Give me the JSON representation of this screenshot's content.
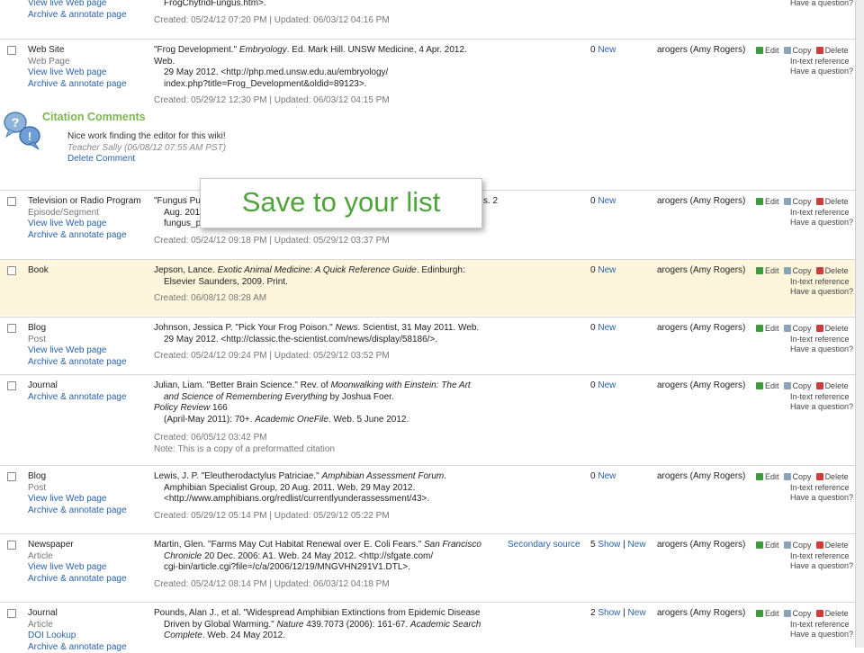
{
  "top_fragment": {
    "type_links": [
      "View live Web page",
      "Archive & annotate page"
    ],
    "cite_tail": "FrogChytridFungus.htm>.",
    "created": "Created: 05/24/12 07:20 PM | Updated: 06/03/12 04:16 PM",
    "question": "Have a question?"
  },
  "actions": {
    "edit": "Edit",
    "copy": "Copy",
    "delete": "Delete",
    "intext": "In-text reference",
    "question": "Have a question?",
    "new": "New",
    "show": "Show",
    "sep": "|"
  },
  "entries": [
    {
      "type": "Web Site",
      "subtype": "Web Page",
      "links": [
        "View live Web page",
        "Archive & annotate page"
      ],
      "cite": [
        "\"Frog Development.\" Embryology. Ed. Mark Hill. UNSW Medicine, 4 Apr. 2012. Web.",
        "29 May 2012. <http://php.med.unsw.edu.au/embryology/",
        "index.php?title=Frog_Development&oldid=89123>."
      ],
      "created": "Created: 05/29/12 12:30 PM | Updated: 06/03/12 04:15 PM",
      "count": "0",
      "owner": "arogers (Amy Rogers)"
    },
    {
      "type": "Television or Radio Program",
      "subtype": "Episode/Segment",
      "links": [
        "View live Web page",
        "Archive & annotate page"
      ],
      "cite": [
        "\"Fungus Pu",
        "Aug. 201",
        "fungus_p"
      ],
      "cite_right": "s. 2",
      "created": "Created: 05/24/12 09:18 PM | Updated: 05/29/12 03:37 PM",
      "count": "0",
      "owner": "arogers (Amy Rogers)"
    },
    {
      "type": "Book",
      "subtype": "",
      "links": [],
      "cite": [
        "Jepson, Lance. Exotic Animal Medicine: A Quick Reference Guide. Edinburgh:",
        "Elsevier Saunders, 2009. Print."
      ],
      "created": "Created: 06/08/12 08:28 AM",
      "count": "0",
      "owner": "arogers (Amy Rogers)"
    },
    {
      "type": "Blog",
      "subtype": "Post",
      "links": [
        "View live Web page",
        "Archive & annotate page"
      ],
      "cite": [
        "Johnson, Jessica P. \"Pick Your Frog Poison.\" News. Scientist, 31 May 2011. Web.",
        "29 May 2012. <http://classic.the-scientist.com/news/display/58186/>."
      ],
      "created": "Created: 05/24/12 09:24 PM | Updated: 05/29/12 03:52 PM",
      "count": "0",
      "owner": "arogers (Amy Rogers)"
    },
    {
      "type": "Journal",
      "subtype": "",
      "links": [
        "Archive & annotate page"
      ],
      "cite": [
        "Julian, Liam. \"Better Brain Science.\" Rev. of Moonwalking with Einstein: The Art",
        "and Science of Remembering Everything by Joshua Foer.",
        "Policy Review 166",
        "(April-May 2011): 70+. Academic OneFile. Web. 5 June 2012."
      ],
      "created": "Created: 06/05/12 03:42 PM",
      "note": "Note: This is a copy of a preformatted citation",
      "count": "0",
      "owner": "arogers (Amy Rogers)"
    },
    {
      "type": "Blog",
      "subtype": "Post",
      "links": [
        "View live Web page",
        "Archive & annotate page"
      ],
      "cite": [
        "Lewis, J. P. \"Eleutherodactylus Patriciae.\" Amphibian Assessment Forum.",
        "Amphibian Specialist Group, 20 Aug. 2011. Web. 29 May 2012.",
        "<http://www.amphibians.org/redlist/currentlyunderassessment/43>."
      ],
      "created": "Created: 05/29/12 05:14 PM | Updated: 05/29/12 05:22 PM",
      "count": "0",
      "owner": "arogers (Amy Rogers)"
    },
    {
      "type": "Newspaper",
      "subtype": "Article",
      "links": [
        "View live Web page",
        "Archive & annotate page"
      ],
      "cite": [
        "Martin, Glen. \"Farms May Cut Habitat Renewal over E. Coli Fears.\" San Francisco",
        "Chronicle 20 Dec. 2006: A1. Web. 24 May 2012. <http://sfgate.com/",
        "cgi-bin/article.cgi?file=/c/a/2006/12/19/MNGVHN291V1.DTL>."
      ],
      "created": "Created: 05/24/12 08:14 PM | Updated: 06/03/12 04:18 PM",
      "source": "Secondary source",
      "count": "5",
      "owner": "arogers (Amy Rogers)"
    },
    {
      "type": "Journal",
      "subtype": "Article",
      "links": [
        "DOI Lookup",
        "Archive & annotate page"
      ],
      "cite": [
        "Pounds, Alan J., et al. \"Widespread Amphibian Extinctions from Epidemic Disease",
        "Driven by Global Warming.\" Nature 439.7073 (2006): 161-67. Academic Search",
        "Complete. Web. 24 May 2012."
      ],
      "created": "",
      "count": "2",
      "owner": "arogers (Amy Rogers)"
    }
  ],
  "comments": {
    "title": "Citation Comments",
    "text": "Nice work finding the editor for this wiki!",
    "signature": "Teacher Sally (06/08/12 07:55 AM PST)",
    "delete_link": "Delete Comment"
  },
  "overlay": {
    "text": "Save to your list"
  },
  "colors": {
    "link": "#2a62a8",
    "accent_green": "#7db54f",
    "overlay_text": "#4ea33b",
    "highlight": "#fdf6dc"
  }
}
